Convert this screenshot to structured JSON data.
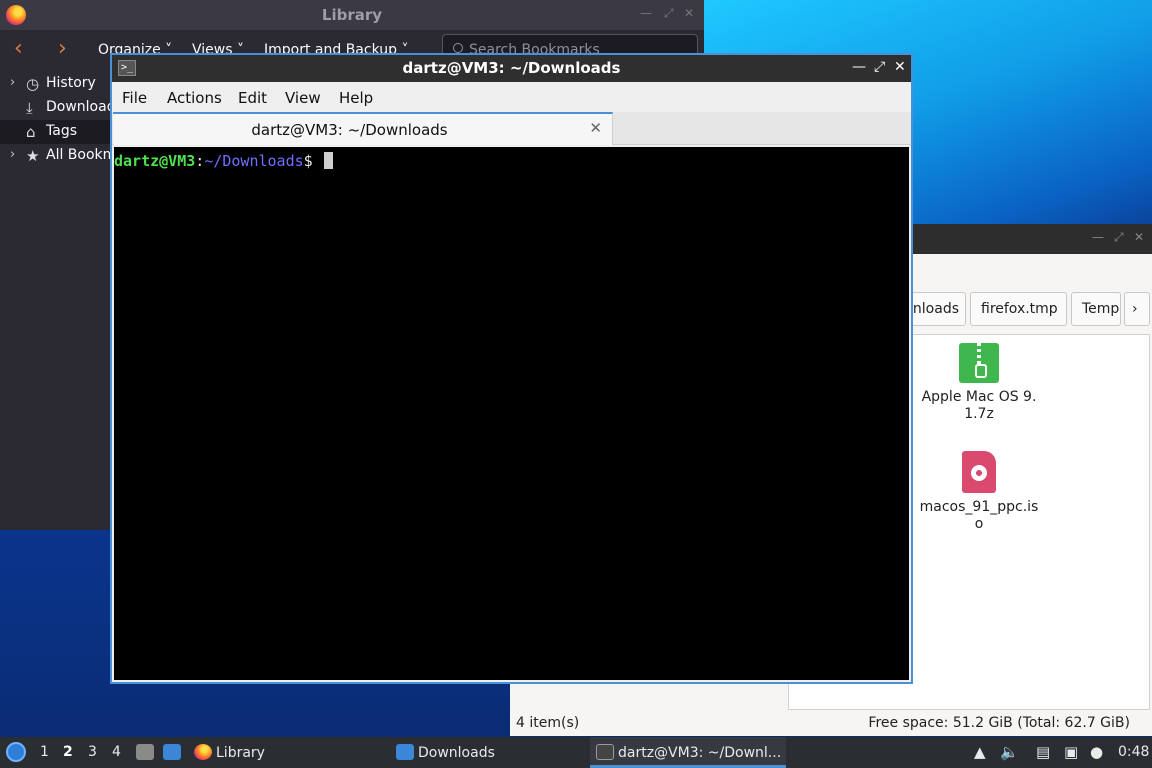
{
  "library": {
    "title": "Library",
    "menus": [
      "Organize",
      "Views",
      "Import and Backup"
    ],
    "search_placeholder": "Search Bookmarks",
    "tree": [
      {
        "label": "History",
        "expandable": true
      },
      {
        "label": "Downloads",
        "expandable": false
      },
      {
        "label": "Tags",
        "expandable": false,
        "selected": true
      },
      {
        "label": "All Bookmarks",
        "expandable": true
      }
    ]
  },
  "terminal": {
    "title": "dartz@VM3: ~/Downloads",
    "menus": [
      "File",
      "Actions",
      "Edit",
      "View",
      "Help"
    ],
    "tab_label": "dartz@VM3: ~/Downloads",
    "prompt": {
      "user_host": "dartz@VM3",
      "sep": ":",
      "path": "~/Downloads",
      "symbol": "$"
    }
  },
  "file_manager": {
    "breadcrumbs": [
      "Downloads",
      "firefox.tmp",
      "Temp"
    ],
    "files": [
      {
        "name": "Apple Mac OS 9.1.7z",
        "icon": "zip-archive-icon"
      },
      {
        "name": "macos_91_ppc.iso",
        "icon": "disc-image-icon"
      }
    ],
    "status_left": "4 item(s)",
    "status_right": "Free space: 51.2 GiB (Total: 62.7 GiB)"
  },
  "taskbar": {
    "workspaces": [
      "1",
      "2",
      "3",
      "4"
    ],
    "active_workspace": "2",
    "tasks": [
      {
        "label": "Library",
        "icon": "firefox-icon"
      },
      {
        "label": "Downloads",
        "icon": "folder-icon"
      },
      {
        "label": "dartz@VM3: ~/Downl...",
        "icon": "terminal-icon",
        "active": true
      }
    ],
    "clock": "0:48"
  },
  "colors": {
    "accent": "#4a90d9",
    "prompt_user": "#4ee04e",
    "prompt_path": "#6f6fff"
  }
}
